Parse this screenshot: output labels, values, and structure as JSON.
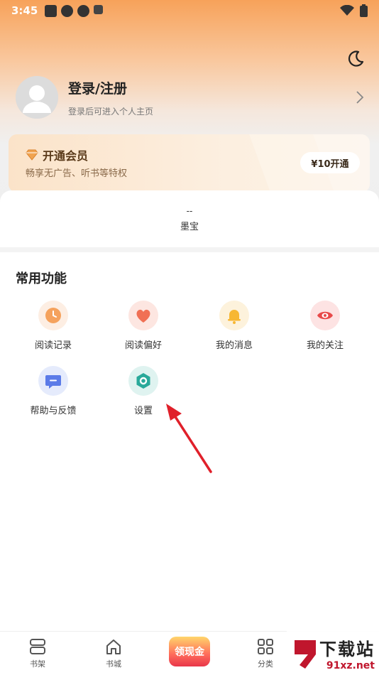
{
  "status_bar": {
    "time": "3:45"
  },
  "profile": {
    "title": "登录/注册",
    "subtitle": "登录后可进入个人主页"
  },
  "vip": {
    "title": "开通会员",
    "subtitle": "畅享无广告、听书等特权",
    "button": "¥10开通"
  },
  "wallet": {
    "value": "--",
    "label": "墨宝"
  },
  "functions": {
    "title": "常用功能",
    "items": [
      {
        "label": "阅读记录",
        "icon": "clock-icon",
        "color": "#f5a25d"
      },
      {
        "label": "阅读偏好",
        "icon": "heart-icon",
        "color": "#f07055"
      },
      {
        "label": "我的消息",
        "icon": "bell-icon",
        "color": "#f7b733"
      },
      {
        "label": "我的关注",
        "icon": "eye-icon",
        "color": "#e84a4a"
      },
      {
        "label": "帮助与反馈",
        "icon": "chat-icon",
        "color": "#5b7be8"
      },
      {
        "label": "设置",
        "icon": "gear-icon",
        "color": "#29a99a"
      }
    ]
  },
  "tabbar": {
    "tabs": [
      {
        "label": "书架",
        "icon": "bookshelf-icon"
      },
      {
        "label": "书城",
        "icon": "home-icon"
      },
      {
        "label": "领现金",
        "icon": "cash-icon"
      },
      {
        "label": "分类",
        "icon": "category-icon"
      }
    ]
  },
  "watermark": {
    "big": "下载站",
    "small": "91xz.net"
  },
  "colors": {
    "accent": "#f7a25a",
    "annotation_arrow": "#e0202a"
  }
}
